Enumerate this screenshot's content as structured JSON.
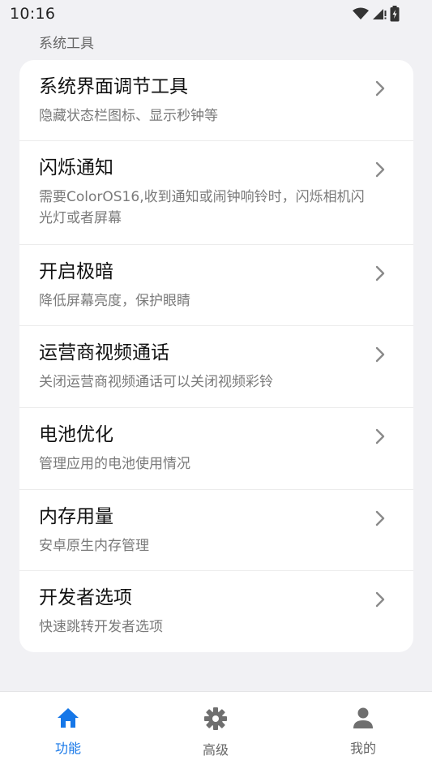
{
  "status_bar": {
    "time": "10:16"
  },
  "section_title": "系统工具",
  "items": [
    {
      "title": "系统界面调节工具",
      "subtitle": "隐藏状态栏图标、显示秒钟等",
      "height": 100
    },
    {
      "title": "闪烁通知",
      "subtitle": "需要ColorOS16,收到通知或闹钟响铃时，闪烁相机闪光灯或者屏幕",
      "height": 128
    },
    {
      "title": "开启极暗",
      "subtitle": "降低屏幕亮度，保护眼睛",
      "height": 100
    },
    {
      "title": "运营商视频通话",
      "subtitle": "关闭运营商视频通话可以关闭视频彩铃",
      "height": 101
    },
    {
      "title": "电池优化",
      "subtitle": "管理应用的电池使用情况",
      "height": 101
    },
    {
      "title": "内存用量",
      "subtitle": "安卓原生内存管理",
      "height": 100
    },
    {
      "title": "开发者选项",
      "subtitle": "快速跳转开发者选项",
      "height": 100
    }
  ],
  "bottom_nav": {
    "items": [
      {
        "label": "功能",
        "icon": "home-icon",
        "active": true
      },
      {
        "label": "高级",
        "icon": "gear-icon",
        "active": false
      },
      {
        "label": "我的",
        "icon": "person-icon",
        "active": false
      }
    ]
  },
  "colors": {
    "accent": "#1677e8",
    "background": "#f1f1f4",
    "card": "#ffffff"
  }
}
